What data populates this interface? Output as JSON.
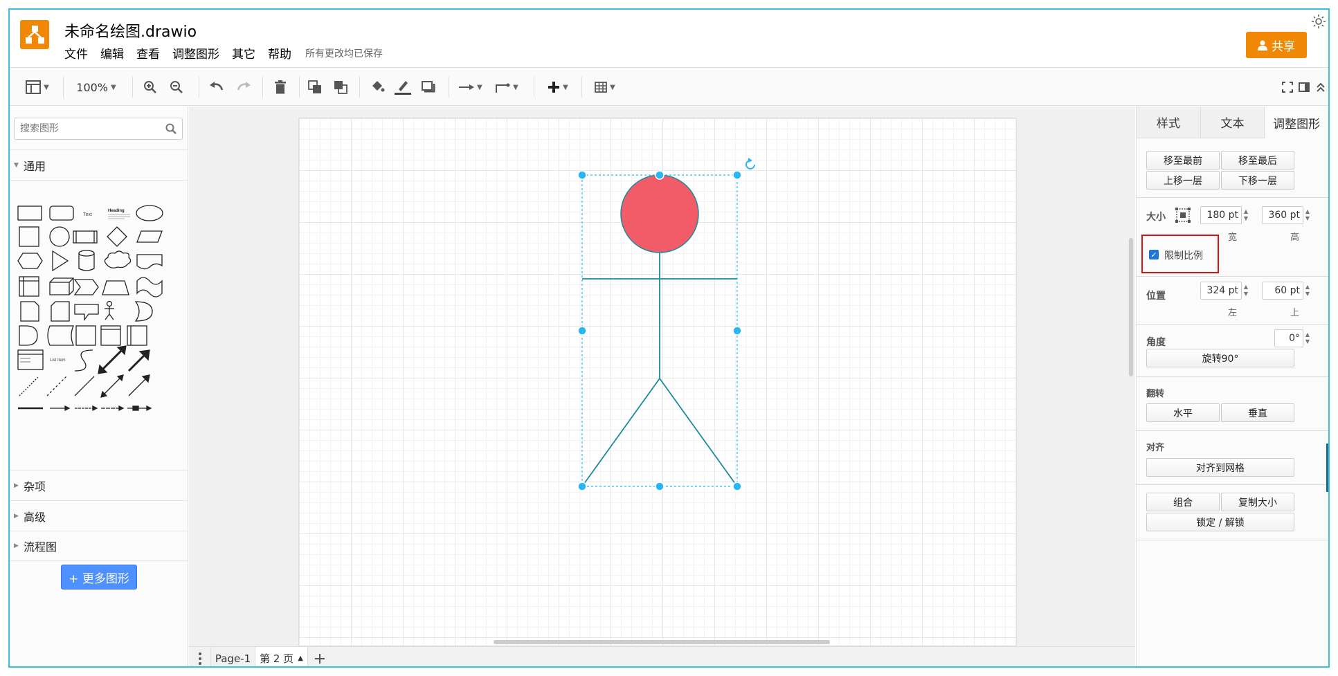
{
  "app": {
    "document_title": "未命名绘图.drawio",
    "menus": [
      "文件",
      "编辑",
      "查看",
      "调整图形",
      "其它",
      "帮助"
    ],
    "save_status": "所有更改均已保存",
    "share_label": "共享",
    "brand_color": "#f08705"
  },
  "toolbar": {
    "zoom": "100%",
    "icons": [
      "format-panel-icon",
      "zoom-in-icon",
      "zoom-out-icon",
      "undo-icon",
      "redo-icon",
      "delete-icon",
      "to-front-icon",
      "to-back-icon",
      "fill-color-icon",
      "line-color-icon",
      "shadow-icon",
      "connection-icon",
      "waypoints-icon",
      "insert-icon",
      "table-icon",
      "fullscreen-icon",
      "toggle-panel-icon",
      "collapse-icon"
    ]
  },
  "sidebar": {
    "search_placeholder": "搜索图形",
    "sections": [
      "通用",
      "杂项",
      "高级",
      "流程图"
    ],
    "shape_text_label": "Text",
    "shape_heading_label": "Heading",
    "shape_list_item_label": "List Item",
    "more_shapes": "+ 更多图形"
  },
  "canvas": {
    "shape": "stick-figure",
    "head_color": "#f25c69",
    "stroke_color": "#1a8a9a",
    "selection_color": "#29b6f2"
  },
  "pages": {
    "tabs": [
      "Page-1",
      "第 2 页"
    ],
    "active": "第 2 页"
  },
  "format_panel": {
    "tabs": [
      "样式",
      "文本",
      "调整图形"
    ],
    "active_tab": "调整图形",
    "order_buttons": [
      "移至最前",
      "移至最后",
      "上移一层",
      "下移一层"
    ],
    "size_label": "大小",
    "width": "180 pt",
    "height": "360 pt",
    "width_label": "宽",
    "height_label": "高",
    "constrain_label": "限制比例",
    "constrain_checked": true,
    "position_label": "位置",
    "left": "324 pt",
    "top": "60 pt",
    "left_label": "左",
    "top_label": "上",
    "angle_label": "角度",
    "angle": "0°",
    "rotate_button": "旋转90°",
    "flip_label": "翻转",
    "flip_horizontal": "水平",
    "flip_vertical": "垂直",
    "align_label": "对齐",
    "align_grid": "对齐到网格",
    "group": "组合",
    "copy_size": "复制大小",
    "lock_unlock": "锁定 / 解锁"
  }
}
